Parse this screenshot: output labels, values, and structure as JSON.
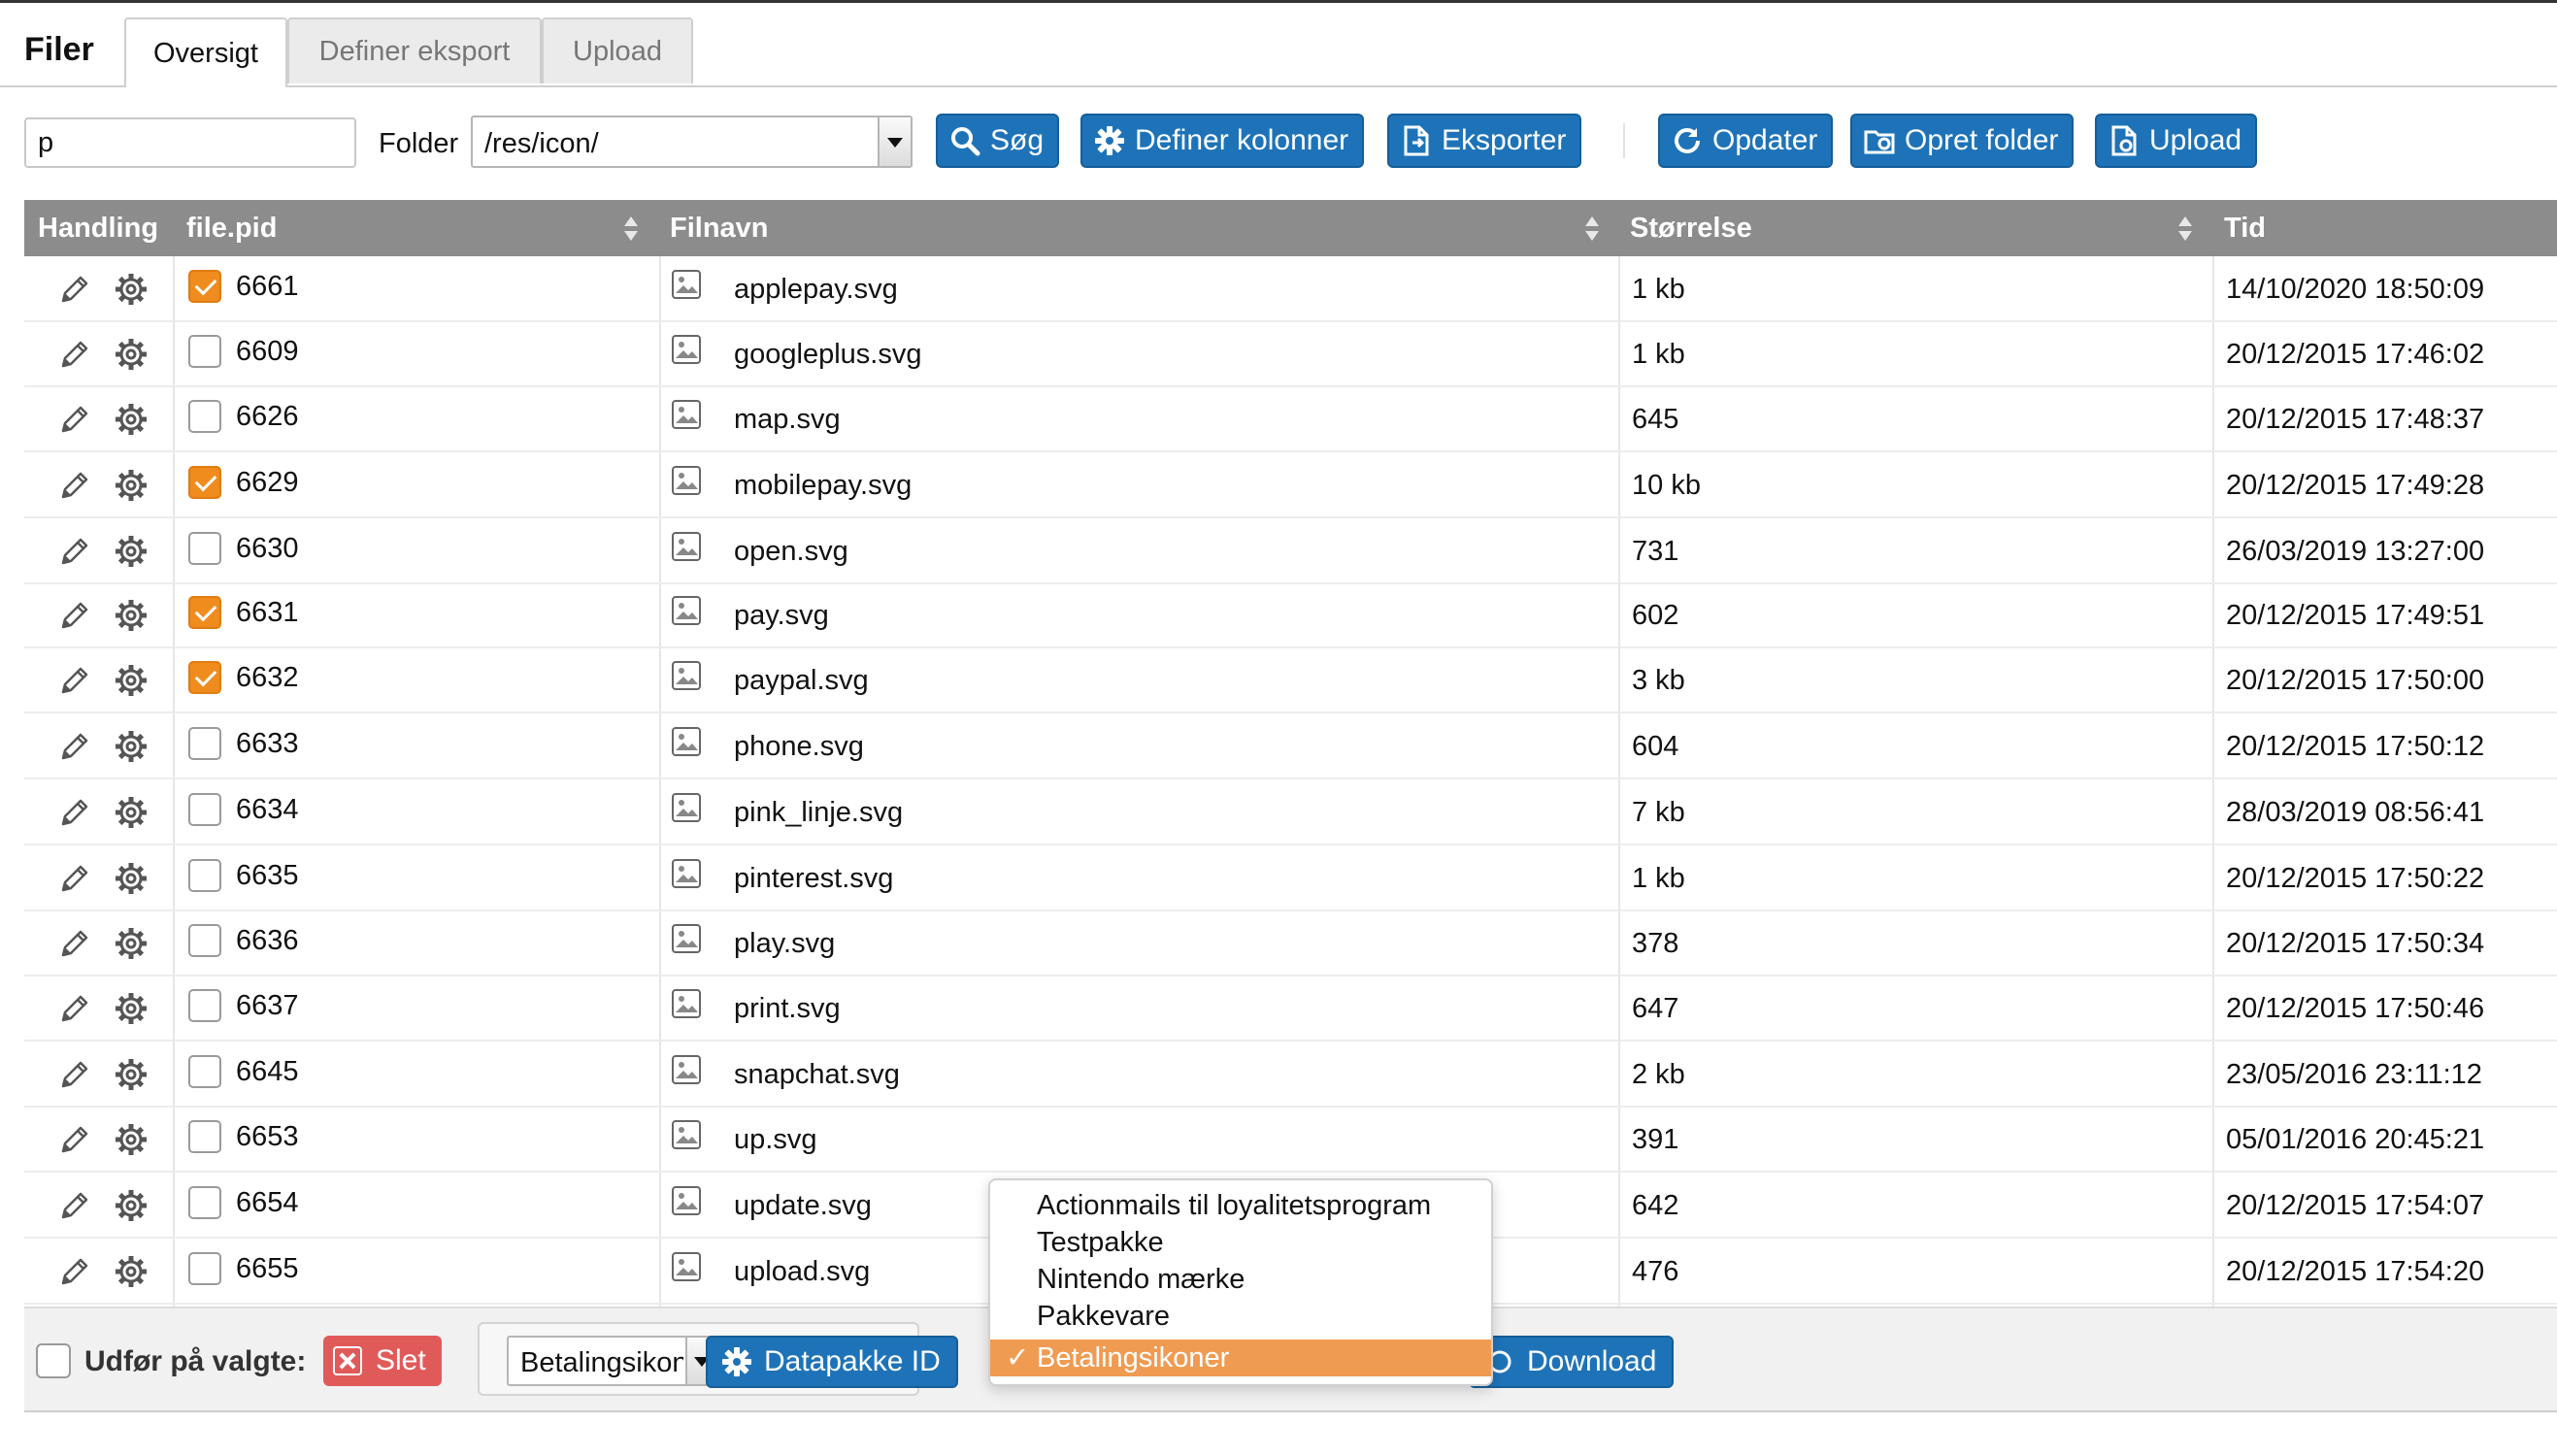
{
  "header": {
    "title": "Filer",
    "tabs": [
      {
        "label": "Oversigt",
        "active": true
      },
      {
        "label": "Definer eksport",
        "active": false
      },
      {
        "label": "Upload",
        "active": false
      }
    ]
  },
  "toolbar": {
    "search_value": "p",
    "folder_label": "Folder",
    "folder_value": "/res/icon/",
    "buttons": {
      "search": "Søg",
      "define_columns": "Definer kolonner",
      "export": "Eksporter",
      "refresh": "Opdater",
      "create_folder": "Opret folder",
      "upload": "Upload"
    }
  },
  "table": {
    "columns": [
      "Handling",
      "file.pid",
      "Filnavn",
      "Størrelse",
      "Tid"
    ],
    "rows": [
      {
        "pid": "6661",
        "name": "applepay.svg",
        "size": "1 kb",
        "time": "14/10/2020 18:50:09",
        "checked": true
      },
      {
        "pid": "6609",
        "name": "googleplus.svg",
        "size": "1 kb",
        "time": "20/12/2015 17:46:02",
        "checked": false
      },
      {
        "pid": "6626",
        "name": "map.svg",
        "size": "645",
        "time": "20/12/2015 17:48:37",
        "checked": false
      },
      {
        "pid": "6629",
        "name": "mobilepay.svg",
        "size": "10 kb",
        "time": "20/12/2015 17:49:28",
        "checked": true
      },
      {
        "pid": "6630",
        "name": "open.svg",
        "size": "731",
        "time": "26/03/2019 13:27:00",
        "checked": false
      },
      {
        "pid": "6631",
        "name": "pay.svg",
        "size": "602",
        "time": "20/12/2015 17:49:51",
        "checked": true
      },
      {
        "pid": "6632",
        "name": "paypal.svg",
        "size": "3 kb",
        "time": "20/12/2015 17:50:00",
        "checked": true
      },
      {
        "pid": "6633",
        "name": "phone.svg",
        "size": "604",
        "time": "20/12/2015 17:50:12",
        "checked": false
      },
      {
        "pid": "6634",
        "name": "pink_linje.svg",
        "size": "7 kb",
        "time": "28/03/2019 08:56:41",
        "checked": false
      },
      {
        "pid": "6635",
        "name": "pinterest.svg",
        "size": "1 kb",
        "time": "20/12/2015 17:50:22",
        "checked": false
      },
      {
        "pid": "6636",
        "name": "play.svg",
        "size": "378",
        "time": "20/12/2015 17:50:34",
        "checked": false
      },
      {
        "pid": "6637",
        "name": "print.svg",
        "size": "647",
        "time": "20/12/2015 17:50:46",
        "checked": false
      },
      {
        "pid": "6645",
        "name": "snapchat.svg",
        "size": "2 kb",
        "time": "23/05/2016 23:11:12",
        "checked": false
      },
      {
        "pid": "6653",
        "name": "up.svg",
        "size": "391",
        "time": "05/01/2016 20:45:21",
        "checked": false
      },
      {
        "pid": "6654",
        "name": "update.svg",
        "size": "642",
        "time": "20/12/2015 17:54:07",
        "checked": false
      },
      {
        "pid": "6655",
        "name": "upload.svg",
        "size": "476",
        "time": "20/12/2015 17:54:20",
        "checked": false
      }
    ]
  },
  "footer": {
    "apply_label": "Udfør på valgte:",
    "delete_label": "Slet",
    "package_value": "Betalingsikoner",
    "package_id_button": "Datapakke ID",
    "download_button": "Download"
  },
  "dropdown": {
    "options": [
      {
        "label": "Actionmails til loyalitetsprogram",
        "selected": false
      },
      {
        "label": "Testpakke",
        "selected": false
      },
      {
        "label": "Nintendo mærke",
        "selected": false
      },
      {
        "label": "Pakkevare",
        "selected": false
      },
      {
        "label": "Betalingsikoner",
        "selected": true
      }
    ],
    "check_mark": "✓"
  },
  "colors": {
    "primary": "#1e73b8",
    "checkbox_checked": "#f08c1e",
    "delete": "#e15a5a",
    "header_bg": "#8c8c8c",
    "dropdown_selected": "#f09b52"
  }
}
